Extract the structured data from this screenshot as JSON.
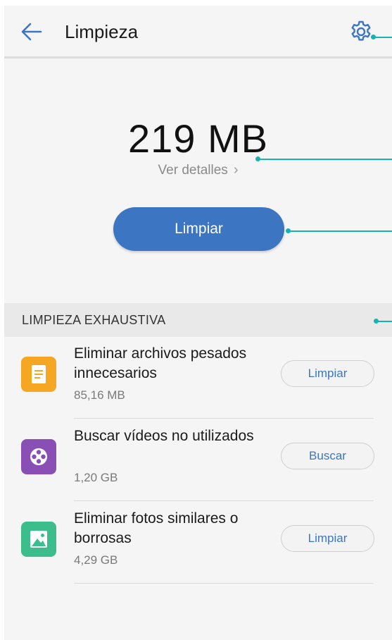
{
  "header": {
    "title": "Limpieza",
    "back_icon": "arrow-left-icon",
    "settings_icon": "gear-icon"
  },
  "summary": {
    "amount": "219 MB",
    "details_label": "Ver detalles",
    "clean_button": "Limpiar"
  },
  "section": {
    "title": "LIMPIEZA EXHAUSTIVA"
  },
  "items": [
    {
      "name": "Eliminar archivos pesados innecesarios",
      "size": "85,16 MB",
      "action": "Limpiar",
      "icon": "document-icon",
      "color": "#f5a623"
    },
    {
      "name": "Buscar vídeos no utilizados",
      "size": "1,20 GB",
      "action": "Buscar",
      "icon": "film-reel-icon",
      "color": "#8a4fb5"
    },
    {
      "name": "Eliminar fotos similares o borrosas",
      "size": "4,29 GB",
      "action": "Limpiar",
      "icon": "image-icon",
      "color": "#3bbd8c"
    }
  ],
  "colors": {
    "accent": "#3c76c2",
    "callout": "#17b2b2",
    "background": "#f5f5f5"
  }
}
